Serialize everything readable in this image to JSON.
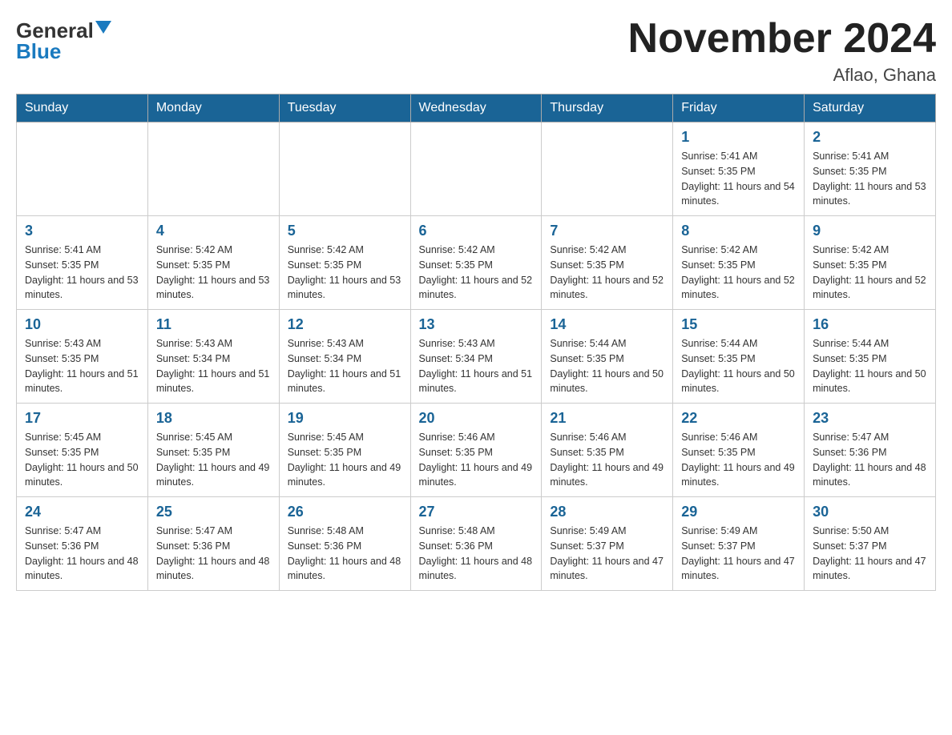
{
  "header": {
    "logo_general": "General",
    "logo_blue": "Blue",
    "month_title": "November 2024",
    "location": "Aflao, Ghana"
  },
  "days_of_week": [
    "Sunday",
    "Monday",
    "Tuesday",
    "Wednesday",
    "Thursday",
    "Friday",
    "Saturday"
  ],
  "weeks": [
    [
      {
        "day": "",
        "info": ""
      },
      {
        "day": "",
        "info": ""
      },
      {
        "day": "",
        "info": ""
      },
      {
        "day": "",
        "info": ""
      },
      {
        "day": "",
        "info": ""
      },
      {
        "day": "1",
        "info": "Sunrise: 5:41 AM\nSunset: 5:35 PM\nDaylight: 11 hours and 54 minutes."
      },
      {
        "day": "2",
        "info": "Sunrise: 5:41 AM\nSunset: 5:35 PM\nDaylight: 11 hours and 53 minutes."
      }
    ],
    [
      {
        "day": "3",
        "info": "Sunrise: 5:41 AM\nSunset: 5:35 PM\nDaylight: 11 hours and 53 minutes."
      },
      {
        "day": "4",
        "info": "Sunrise: 5:42 AM\nSunset: 5:35 PM\nDaylight: 11 hours and 53 minutes."
      },
      {
        "day": "5",
        "info": "Sunrise: 5:42 AM\nSunset: 5:35 PM\nDaylight: 11 hours and 53 minutes."
      },
      {
        "day": "6",
        "info": "Sunrise: 5:42 AM\nSunset: 5:35 PM\nDaylight: 11 hours and 52 minutes."
      },
      {
        "day": "7",
        "info": "Sunrise: 5:42 AM\nSunset: 5:35 PM\nDaylight: 11 hours and 52 minutes."
      },
      {
        "day": "8",
        "info": "Sunrise: 5:42 AM\nSunset: 5:35 PM\nDaylight: 11 hours and 52 minutes."
      },
      {
        "day": "9",
        "info": "Sunrise: 5:42 AM\nSunset: 5:35 PM\nDaylight: 11 hours and 52 minutes."
      }
    ],
    [
      {
        "day": "10",
        "info": "Sunrise: 5:43 AM\nSunset: 5:35 PM\nDaylight: 11 hours and 51 minutes."
      },
      {
        "day": "11",
        "info": "Sunrise: 5:43 AM\nSunset: 5:34 PM\nDaylight: 11 hours and 51 minutes."
      },
      {
        "day": "12",
        "info": "Sunrise: 5:43 AM\nSunset: 5:34 PM\nDaylight: 11 hours and 51 minutes."
      },
      {
        "day": "13",
        "info": "Sunrise: 5:43 AM\nSunset: 5:34 PM\nDaylight: 11 hours and 51 minutes."
      },
      {
        "day": "14",
        "info": "Sunrise: 5:44 AM\nSunset: 5:35 PM\nDaylight: 11 hours and 50 minutes."
      },
      {
        "day": "15",
        "info": "Sunrise: 5:44 AM\nSunset: 5:35 PM\nDaylight: 11 hours and 50 minutes."
      },
      {
        "day": "16",
        "info": "Sunrise: 5:44 AM\nSunset: 5:35 PM\nDaylight: 11 hours and 50 minutes."
      }
    ],
    [
      {
        "day": "17",
        "info": "Sunrise: 5:45 AM\nSunset: 5:35 PM\nDaylight: 11 hours and 50 minutes."
      },
      {
        "day": "18",
        "info": "Sunrise: 5:45 AM\nSunset: 5:35 PM\nDaylight: 11 hours and 49 minutes."
      },
      {
        "day": "19",
        "info": "Sunrise: 5:45 AM\nSunset: 5:35 PM\nDaylight: 11 hours and 49 minutes."
      },
      {
        "day": "20",
        "info": "Sunrise: 5:46 AM\nSunset: 5:35 PM\nDaylight: 11 hours and 49 minutes."
      },
      {
        "day": "21",
        "info": "Sunrise: 5:46 AM\nSunset: 5:35 PM\nDaylight: 11 hours and 49 minutes."
      },
      {
        "day": "22",
        "info": "Sunrise: 5:46 AM\nSunset: 5:35 PM\nDaylight: 11 hours and 49 minutes."
      },
      {
        "day": "23",
        "info": "Sunrise: 5:47 AM\nSunset: 5:36 PM\nDaylight: 11 hours and 48 minutes."
      }
    ],
    [
      {
        "day": "24",
        "info": "Sunrise: 5:47 AM\nSunset: 5:36 PM\nDaylight: 11 hours and 48 minutes."
      },
      {
        "day": "25",
        "info": "Sunrise: 5:47 AM\nSunset: 5:36 PM\nDaylight: 11 hours and 48 minutes."
      },
      {
        "day": "26",
        "info": "Sunrise: 5:48 AM\nSunset: 5:36 PM\nDaylight: 11 hours and 48 minutes."
      },
      {
        "day": "27",
        "info": "Sunrise: 5:48 AM\nSunset: 5:36 PM\nDaylight: 11 hours and 48 minutes."
      },
      {
        "day": "28",
        "info": "Sunrise: 5:49 AM\nSunset: 5:37 PM\nDaylight: 11 hours and 47 minutes."
      },
      {
        "day": "29",
        "info": "Sunrise: 5:49 AM\nSunset: 5:37 PM\nDaylight: 11 hours and 47 minutes."
      },
      {
        "day": "30",
        "info": "Sunrise: 5:50 AM\nSunset: 5:37 PM\nDaylight: 11 hours and 47 minutes."
      }
    ]
  ]
}
